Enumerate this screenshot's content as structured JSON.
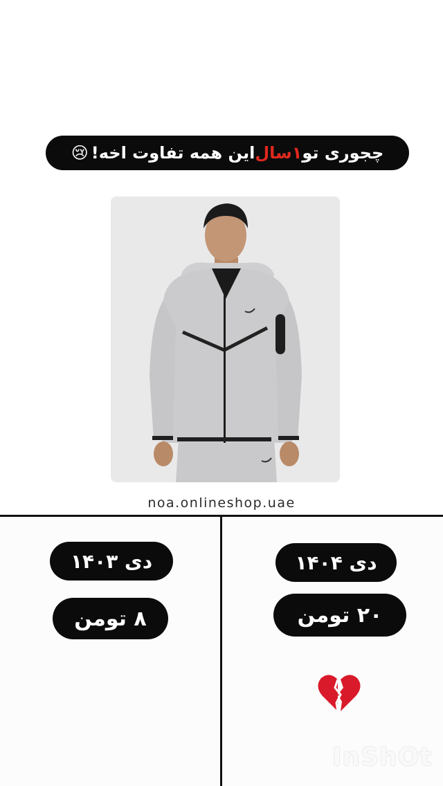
{
  "headline": {
    "part1": "چجوری تو ",
    "highlight": "۱سال",
    "part2": " این همه تفاوت اخه!",
    "emoji": "😢"
  },
  "shop_handle": "noa.onlineshop.uae",
  "left": {
    "date": "دی ۱۴۰۳",
    "price": "۸ تومن"
  },
  "right": {
    "date": "دی ۱۴۰۴",
    "price": "۲۰ تومن"
  },
  "icons": {
    "heart": "broken-heart-icon"
  },
  "colors": {
    "accent_red": "#e0281f",
    "pill_black": "#0b0b0b"
  },
  "watermark": "InShOt"
}
